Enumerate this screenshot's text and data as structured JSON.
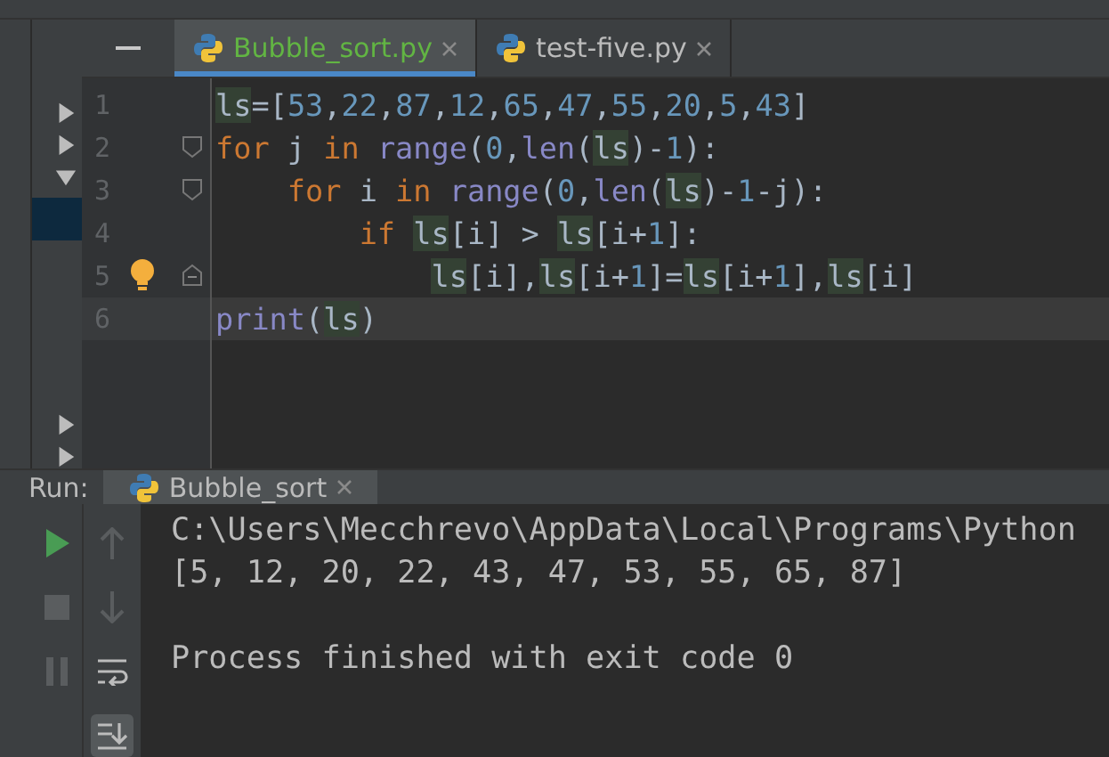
{
  "editor_tabs": [
    {
      "label": "Bubble_sort.py",
      "selected": true
    },
    {
      "label": "test-five.py",
      "selected": false
    }
  ],
  "code_lines": [
    {
      "number": "1",
      "current": false,
      "fold_start": false,
      "fold_end": false,
      "bulb": false,
      "tokens": [
        {
          "kind": "var",
          "text": "ls"
        },
        {
          "kind": "text",
          "text": "=["
        },
        {
          "kind": "num",
          "text": "53"
        },
        {
          "kind": "text",
          "text": ","
        },
        {
          "kind": "num",
          "text": "22"
        },
        {
          "kind": "text",
          "text": ","
        },
        {
          "kind": "num",
          "text": "87"
        },
        {
          "kind": "text",
          "text": ","
        },
        {
          "kind": "num",
          "text": "12"
        },
        {
          "kind": "text",
          "text": ","
        },
        {
          "kind": "num",
          "text": "65"
        },
        {
          "kind": "text",
          "text": ","
        },
        {
          "kind": "num",
          "text": "47"
        },
        {
          "kind": "text",
          "text": ","
        },
        {
          "kind": "num",
          "text": "55"
        },
        {
          "kind": "text",
          "text": ","
        },
        {
          "kind": "num",
          "text": "20"
        },
        {
          "kind": "text",
          "text": ","
        },
        {
          "kind": "num",
          "text": "5"
        },
        {
          "kind": "text",
          "text": ","
        },
        {
          "kind": "num",
          "text": "43"
        },
        {
          "kind": "text",
          "text": "]"
        }
      ]
    },
    {
      "number": "2",
      "current": false,
      "fold_start": true,
      "fold_end": false,
      "bulb": false,
      "tokens": [
        {
          "kind": "kw",
          "text": "for"
        },
        {
          "kind": "text",
          "text": " j "
        },
        {
          "kind": "kw",
          "text": "in "
        },
        {
          "kind": "fn",
          "text": "range"
        },
        {
          "kind": "text",
          "text": "("
        },
        {
          "kind": "num",
          "text": "0"
        },
        {
          "kind": "text",
          "text": ","
        },
        {
          "kind": "fn",
          "text": "len"
        },
        {
          "kind": "text",
          "text": "("
        },
        {
          "kind": "var",
          "text": "ls"
        },
        {
          "kind": "text",
          "text": ")-"
        },
        {
          "kind": "num",
          "text": "1"
        },
        {
          "kind": "text",
          "text": "):"
        }
      ]
    },
    {
      "number": "3",
      "current": false,
      "fold_start": true,
      "fold_end": false,
      "bulb": false,
      "tokens": [
        {
          "kind": "kw",
          "text": "    for"
        },
        {
          "kind": "text",
          "text": " i "
        },
        {
          "kind": "kw",
          "text": "in "
        },
        {
          "kind": "fn",
          "text": "range"
        },
        {
          "kind": "text",
          "text": "("
        },
        {
          "kind": "num",
          "text": "0"
        },
        {
          "kind": "text",
          "text": ","
        },
        {
          "kind": "fn",
          "text": "len"
        },
        {
          "kind": "text",
          "text": "("
        },
        {
          "kind": "var",
          "text": "ls"
        },
        {
          "kind": "text",
          "text": ")-"
        },
        {
          "kind": "num",
          "text": "1"
        },
        {
          "kind": "text",
          "text": "-j):"
        }
      ]
    },
    {
      "number": "4",
      "current": false,
      "fold_start": false,
      "fold_end": false,
      "bulb": false,
      "tokens": [
        {
          "kind": "kw",
          "text": "        if "
        },
        {
          "kind": "var",
          "text": "ls"
        },
        {
          "kind": "text",
          "text": "[i] > "
        },
        {
          "kind": "var",
          "text": "ls"
        },
        {
          "kind": "text",
          "text": "[i+"
        },
        {
          "kind": "num",
          "text": "1"
        },
        {
          "kind": "text",
          "text": "]:"
        }
      ]
    },
    {
      "number": "5",
      "current": false,
      "fold_start": false,
      "fold_end": true,
      "bulb": true,
      "tokens": [
        {
          "kind": "var",
          "text": "            ls"
        },
        {
          "kind": "text",
          "text": "[i],"
        },
        {
          "kind": "var",
          "text": "ls"
        },
        {
          "kind": "text",
          "text": "[i+"
        },
        {
          "kind": "num",
          "text": "1"
        },
        {
          "kind": "text",
          "text": "]="
        },
        {
          "kind": "var",
          "text": "ls"
        },
        {
          "kind": "text",
          "text": "[i+"
        },
        {
          "kind": "num",
          "text": "1"
        },
        {
          "kind": "text",
          "text": "],"
        },
        {
          "kind": "var",
          "text": "ls"
        },
        {
          "kind": "text",
          "text": "[i]"
        }
      ]
    },
    {
      "number": "6",
      "current": true,
      "fold_start": false,
      "fold_end": false,
      "bulb": false,
      "tokens": [
        {
          "kind": "fn",
          "text": "print"
        },
        {
          "kind": "text",
          "text": "("
        },
        {
          "kind": "var",
          "text": "ls"
        },
        {
          "kind": "text",
          "text": ")"
        }
      ]
    }
  ],
  "run_panel": {
    "label": "Run:",
    "tab": {
      "label": "Bubble_sort",
      "selected": true
    },
    "output": [
      "C:\\Users\\Mecchrevo\\AppData\\Local\\Programs\\Python",
      "[5, 12, 20, 22, 43, 47, 53, 55, 65, 87]"
    ],
    "exit_message": "Process finished with exit code 0"
  }
}
